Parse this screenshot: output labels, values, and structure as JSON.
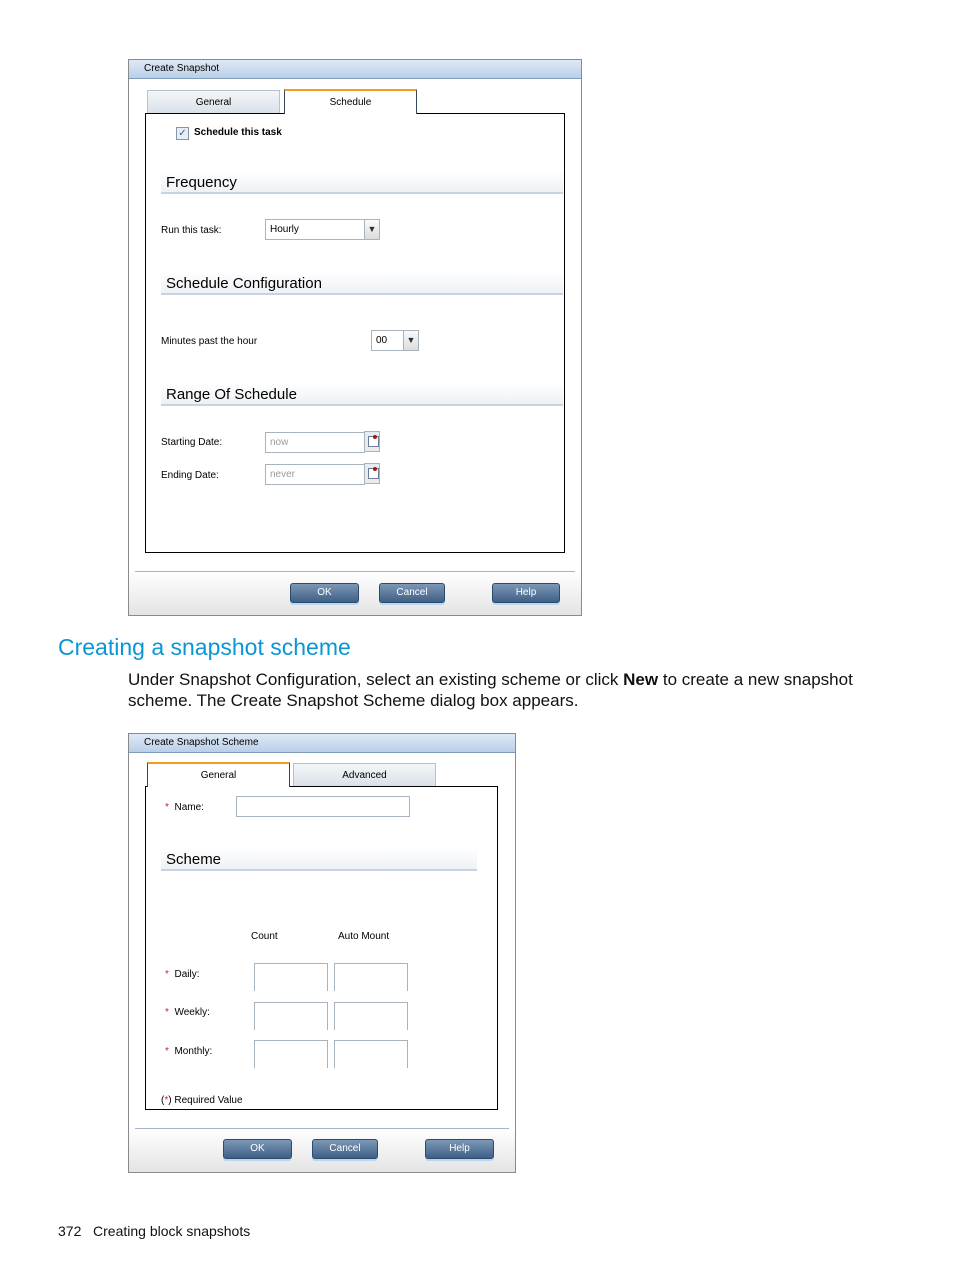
{
  "dialog1": {
    "title": "Create Snapshot",
    "tabs": [
      {
        "label": "General",
        "active": false
      },
      {
        "label": "Schedule",
        "active": true
      }
    ],
    "schedule_checkbox": {
      "label": "Schedule this task",
      "checked": true
    },
    "frequency": {
      "heading": "Frequency",
      "run_label": "Run this task:",
      "run_value": "Hourly"
    },
    "config": {
      "heading": "Schedule Configuration",
      "minutes_label": "Minutes past the hour",
      "minutes_value": "00"
    },
    "range": {
      "heading": "Range Of Schedule",
      "start_label": "Starting Date:",
      "start_placeholder": "now",
      "end_label": "Ending Date:",
      "end_placeholder": "never"
    },
    "buttons": {
      "ok": "OK",
      "cancel": "Cancel",
      "help": "Help"
    }
  },
  "section": {
    "heading": "Creating a snapshot scheme",
    "para_1": "Under Snapshot Configuration, select an existing scheme or click ",
    "para_bold": "New",
    "para_2": " to create a new snapshot scheme. The Create Snapshot Scheme dialog box appears."
  },
  "dialog2": {
    "title": "Create Snapshot Scheme",
    "tabs": [
      {
        "label": "General",
        "active": true
      },
      {
        "label": "Advanced",
        "active": false
      }
    ],
    "required_mark": "*",
    "name_label": "Name:",
    "name_value": "",
    "scheme_heading": "Scheme",
    "columns": [
      "Count",
      "Auto Mount"
    ],
    "rows": [
      {
        "label": "Daily:"
      },
      {
        "label": "Weekly:"
      },
      {
        "label": "Monthly:"
      }
    ],
    "required_note_open": "(",
    "required_note_close": ") Required Value",
    "buttons": {
      "ok": "OK",
      "cancel": "Cancel",
      "help": "Help"
    }
  },
  "footer": {
    "page_number": "372",
    "chapter": "Creating block snapshots"
  },
  "colors": {
    "heading": "#0a96d6",
    "required": "#d0202a",
    "tab_accent": "#f39c1f"
  }
}
